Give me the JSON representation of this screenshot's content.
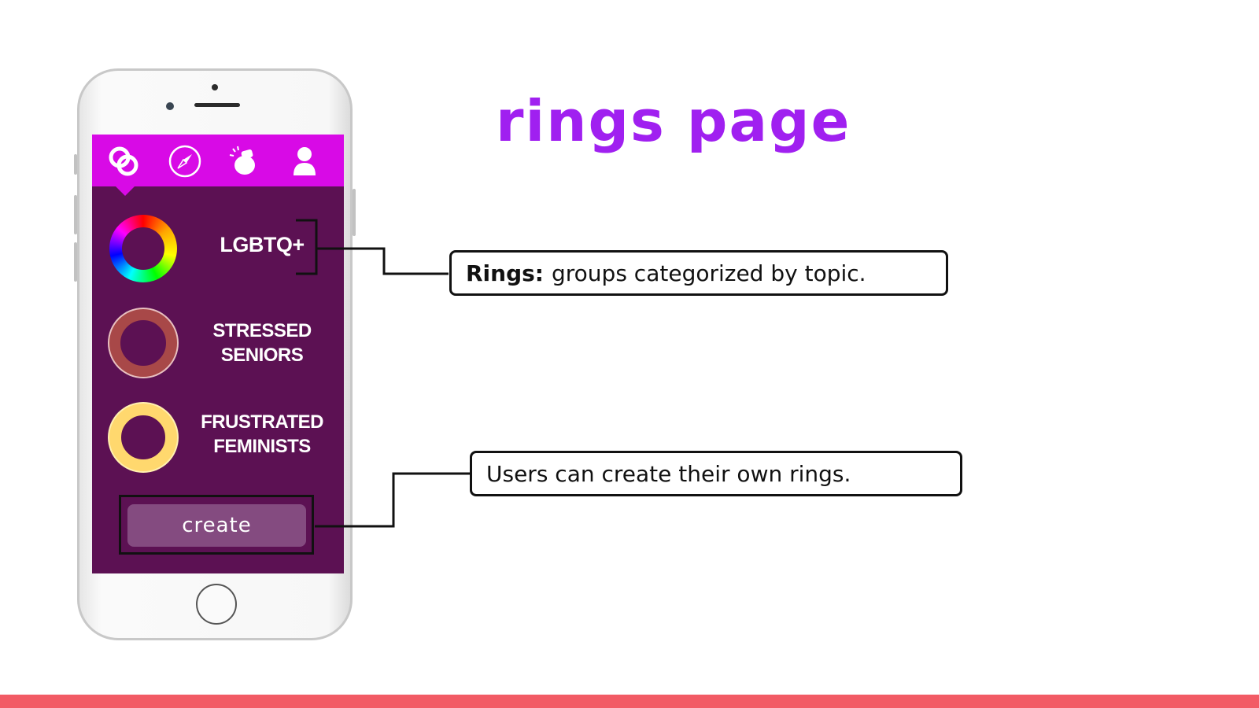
{
  "slide": {
    "title": "rings page"
  },
  "phone": {
    "nav": [
      {
        "name": "rings-icon"
      },
      {
        "name": "compass-icon"
      },
      {
        "name": "notification-icon"
      },
      {
        "name": "profile-icon"
      }
    ],
    "rings": [
      {
        "label": "LGBTQ+",
        "style": "rainbow"
      },
      {
        "label": "STRESSED\nSENIORS",
        "color": "#a84848"
      },
      {
        "label": "FRUSTRATED\nFEMINISTS",
        "color": "#ffd86e"
      }
    ],
    "create_label": "create"
  },
  "callouts": {
    "rings_term": "Rings:",
    "rings_desc": "groups categorized by topic.",
    "create_desc": "Users can create their own rings."
  },
  "colors": {
    "title": "#a020f0",
    "topbar": "#d80ae6",
    "screen": "#5c1153",
    "bottom_bar": "#f25b65"
  }
}
